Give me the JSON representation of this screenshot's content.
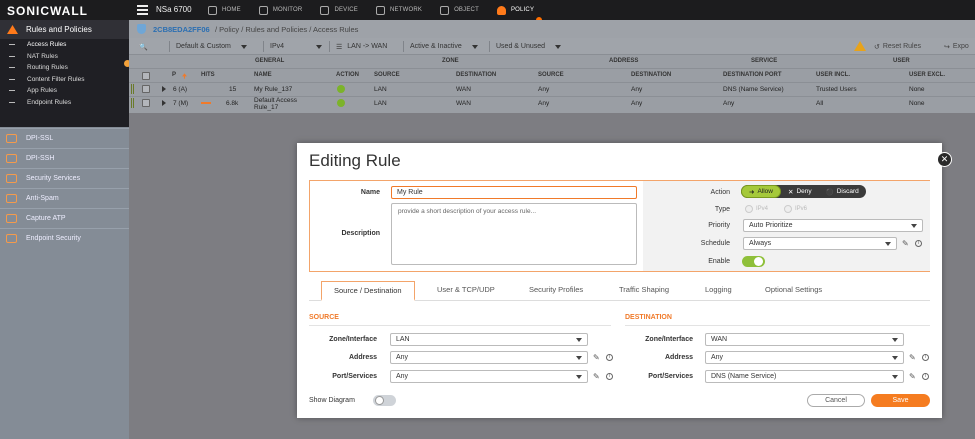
{
  "brand": "SONICWALL",
  "device": "NSa 6700",
  "topnav": [
    {
      "label": "HOME",
      "icon": "home-icon"
    },
    {
      "label": "MONITOR",
      "icon": "monitor-icon"
    },
    {
      "label": "DEVICE",
      "icon": "device-icon"
    },
    {
      "label": "NETWORK",
      "icon": "network-icon"
    },
    {
      "label": "OBJECT",
      "icon": "object-icon"
    },
    {
      "label": "POLICY",
      "icon": "policy-icon",
      "active": true
    }
  ],
  "sidebar": {
    "header": "Rules and Policies",
    "items": [
      "Access Rules",
      "NAT Rules",
      "Routing Rules",
      "Content Filter Rules",
      "App Rules",
      "Endpoint Rules"
    ],
    "active_item": "Access Rules",
    "sections": [
      "DPI-SSL",
      "DPI-SSH",
      "Security Services",
      "Anti-Spam",
      "Capture ATP",
      "Endpoint Security"
    ]
  },
  "breadcrumb": {
    "serial": "2CB8EDA2FF06",
    "path": "/   Policy   /   Rules and Policies   /   Access Rules"
  },
  "toolbar": {
    "view": "Default & Custom",
    "ip": "IPv4",
    "zones": "LAN -> WAN",
    "status": "Active & Inactive",
    "usage": "Used & Unused",
    "reset": "Reset Rules",
    "export": "Expo"
  },
  "table": {
    "groups": [
      "GENERAL",
      "ZONE",
      "ADDRESS",
      "SERVICE",
      "USER"
    ],
    "columns": [
      "P",
      "HITS",
      "NAME",
      "ACTION",
      "SOURCE",
      "DESTINATION",
      "SOURCE",
      "DESTINATION",
      "DESTINATION PORT",
      "USER INCL.",
      "USER EXCL."
    ],
    "rows": [
      {
        "priority": "6 (A)",
        "hits": "15",
        "name": "My Rule_137",
        "src_zone": "LAN",
        "dst_zone": "WAN",
        "src_addr": "Any",
        "dst_addr": "Any",
        "dst_port": "DNS (Name Service)",
        "user_incl": "Trusted Users",
        "user_excl": "None"
      },
      {
        "priority": "7 (M)",
        "hits": "6.8k",
        "name": "Default Access Rule_17",
        "src_zone": "LAN",
        "dst_zone": "WAN",
        "src_addr": "Any",
        "dst_addr": "Any",
        "dst_port": "Any",
        "user_incl": "All",
        "user_excl": "None"
      }
    ]
  },
  "modal": {
    "title": "Editing Rule",
    "name_label": "Name",
    "name_value": "My Rule",
    "description_label": "Description",
    "description_placeholder": "provide a short description of your access rule...",
    "action_label": "Action",
    "actions": [
      "Allow",
      "Deny",
      "Discard"
    ],
    "selected_action": "Allow",
    "type_label": "Type",
    "types": [
      "IPv4",
      "IPv6"
    ],
    "priority_label": "Priority",
    "priority_value": "Auto Prioritize",
    "schedule_label": "Schedule",
    "schedule_value": "Always",
    "enable_label": "Enable",
    "enable_on": true,
    "tabs": [
      "Source / Destination",
      "User & TCP/UDP",
      "Security Profiles",
      "Traffic Shaping",
      "Logging",
      "Optional Settings"
    ],
    "active_tab": "Source / Destination",
    "source": {
      "title": "SOURCE",
      "zone_label": "Zone/Interface",
      "zone": "LAN",
      "address_label": "Address",
      "address": "Any",
      "port_label": "Port/Services",
      "port": "Any"
    },
    "destination": {
      "title": "DESTINATION",
      "zone_label": "Zone/Interface",
      "zone": "WAN",
      "address_label": "Address",
      "address": "Any",
      "port_label": "Port/Services",
      "port": "DNS (Name Service)"
    },
    "show_diagram_label": "Show Diagram",
    "show_diagram_on": false,
    "cancel": "Cancel",
    "save": "Save"
  },
  "colors": {
    "accent": "#f57c20",
    "allow": "#a5c93a",
    "link": "#2b6fb2"
  }
}
